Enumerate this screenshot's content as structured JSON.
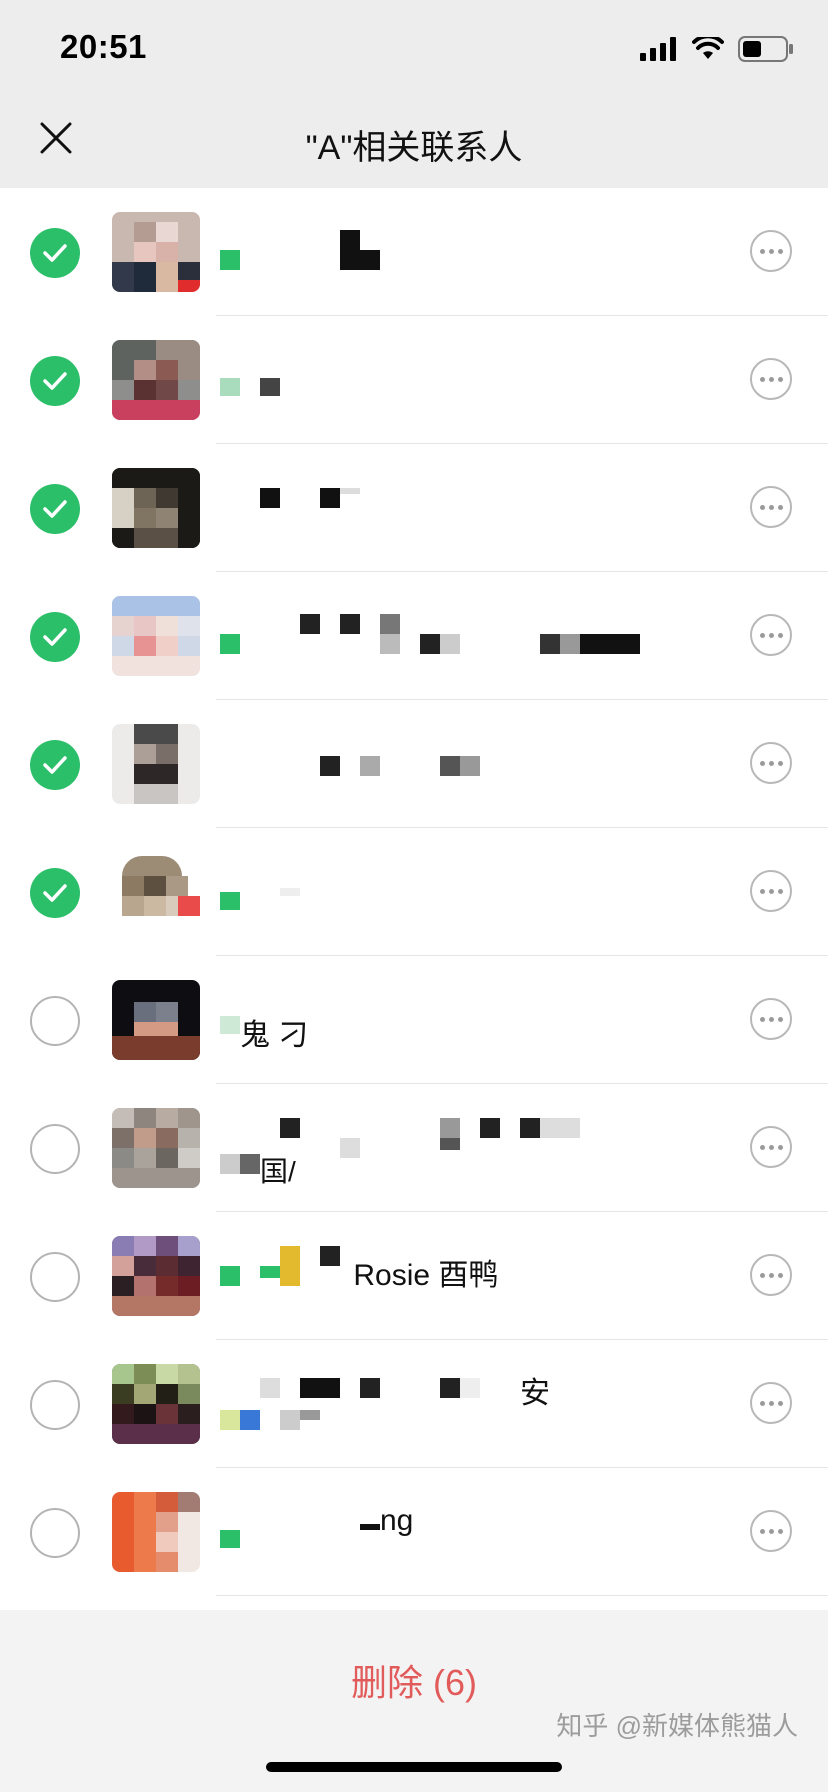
{
  "status_bar": {
    "time": "20:51"
  },
  "nav": {
    "title": "\"A\"相关联系人"
  },
  "contacts": [
    {
      "checked": true
    },
    {
      "checked": true
    },
    {
      "checked": true
    },
    {
      "checked": true
    },
    {
      "checked": true
    },
    {
      "checked": true
    },
    {
      "checked": false,
      "name_visible": "                                            "
    },
    {
      "checked": false
    },
    {
      "checked": false,
      "name_visible": "Rosie 酉鸭"
    },
    {
      "checked": false,
      "name_visible": "安"
    },
    {
      "checked": false,
      "name_visible": "ng"
    }
  ],
  "footer": {
    "delete_label": "删除 (6)",
    "watermark": "知乎 @新媒体熊猫人"
  },
  "colors": {
    "check_green": "#2bbf6a",
    "delete_red": "#e25b5b"
  },
  "icons": [
    "signal-icon",
    "wifi-icon",
    "battery-icon",
    "close-icon",
    "checkmark-icon",
    "more-icon"
  ]
}
